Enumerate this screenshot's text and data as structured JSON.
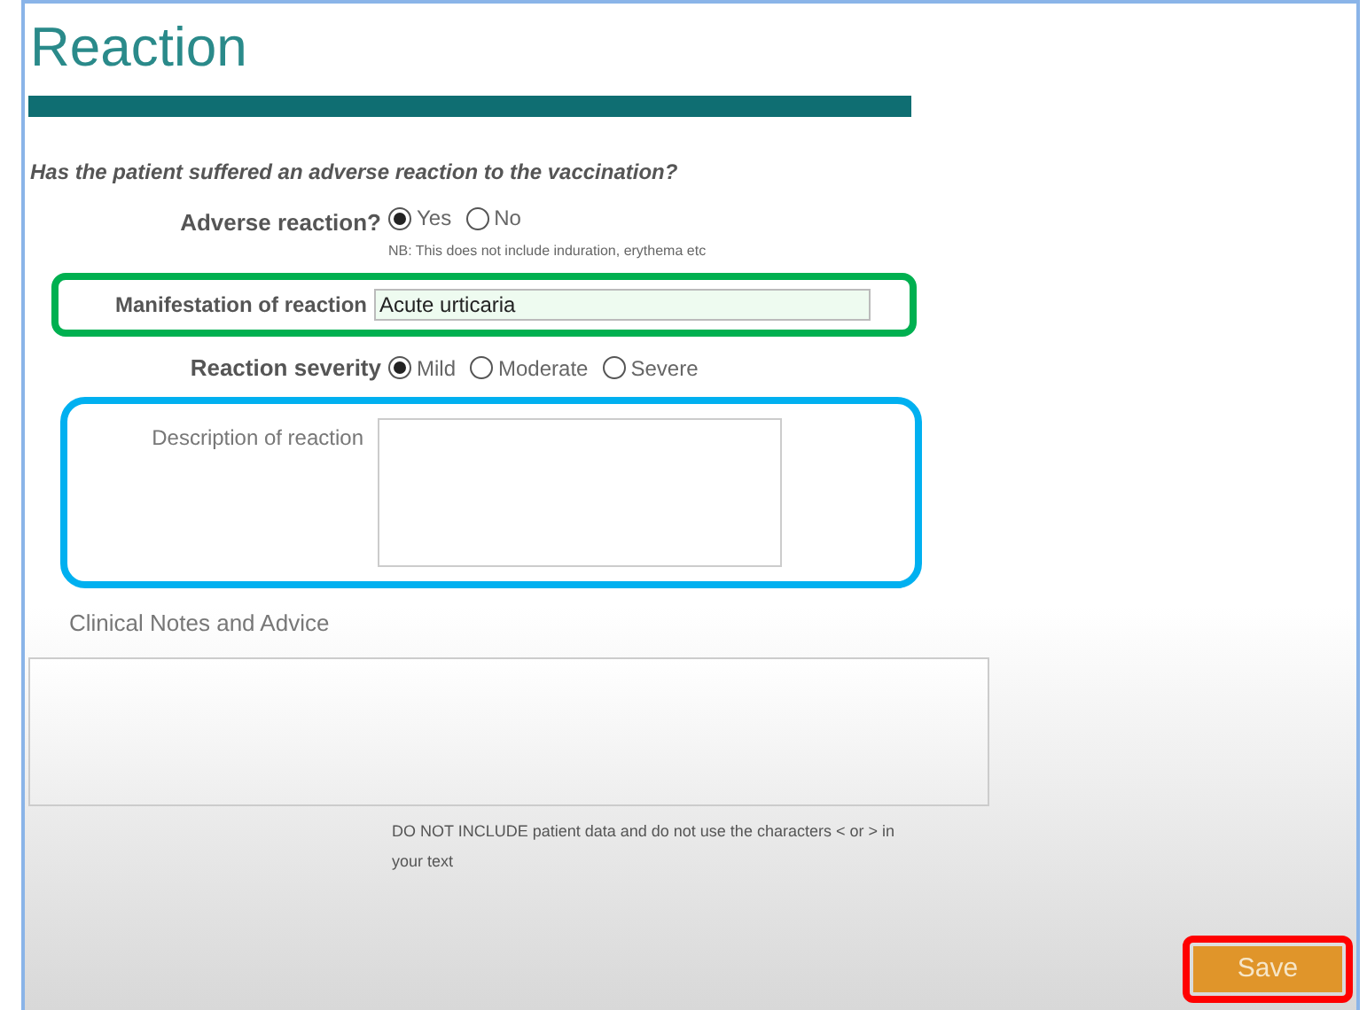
{
  "title": "Reaction",
  "question": "Has the patient suffered an adverse reaction to the vaccination?",
  "adverse": {
    "label": "Adverse reaction?",
    "options": [
      {
        "label": "Yes",
        "selected": true
      },
      {
        "label": "No",
        "selected": false
      }
    ],
    "note": "NB: This does not include induration, erythema etc"
  },
  "manifestation": {
    "label": "Manifestation of reaction",
    "value": "Acute urticaria",
    "color": "#00b050"
  },
  "severity": {
    "label": "Reaction severity",
    "options": [
      {
        "label": "Mild",
        "selected": true
      },
      {
        "label": "Moderate",
        "selected": false
      },
      {
        "label": "Severe",
        "selected": false
      }
    ]
  },
  "description": {
    "label": "Description of reaction",
    "color": "#00b0f0"
  },
  "notes": {
    "label": "Clinical Notes and Advice",
    "hint": "DO NOT INCLUDE patient data and do not use the characters < or > in your text"
  },
  "save": {
    "label": "Save",
    "color": "#ff0000"
  }
}
